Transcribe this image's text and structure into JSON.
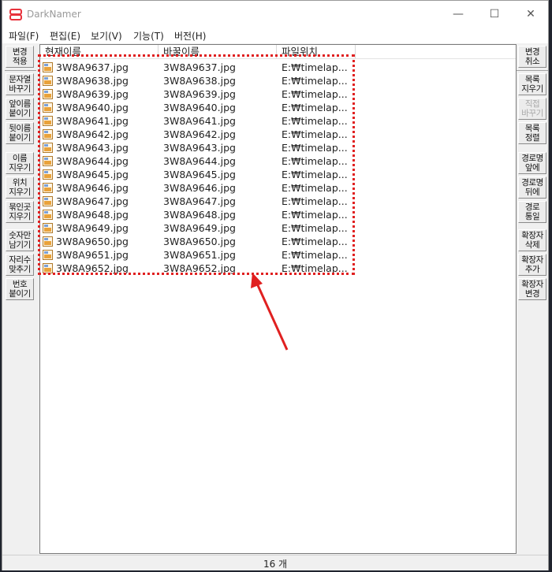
{
  "window": {
    "title": "DarkNamer",
    "minimize": "—",
    "maximize": "☐",
    "close": "✕"
  },
  "menu": [
    {
      "label": "파일(F)"
    },
    {
      "label": "편집(E)"
    },
    {
      "label": "보기(V)"
    },
    {
      "label": "기능(T)"
    },
    {
      "label": "버전(H)"
    }
  ],
  "left_buttons": [
    {
      "label": "변경\n적용"
    },
    {
      "label": "문자열\n바꾸기"
    },
    {
      "label": "앞이름\n붙이기"
    },
    {
      "label": "뒷이름\n붙이기"
    },
    {
      "label": "이름\n지우기"
    },
    {
      "label": "위치\n지우기"
    },
    {
      "label": "묶인곳\n지우기"
    },
    {
      "label": "숫자만\n남기기"
    },
    {
      "label": "자리수\n맞추기"
    },
    {
      "label": "번호\n붙이기"
    }
  ],
  "right_buttons": [
    {
      "label": "변경\n취소",
      "enabled": true
    },
    {
      "label": "목록\n지우기",
      "enabled": true
    },
    {
      "label": "직접\n바꾸기",
      "enabled": false
    },
    {
      "label": "목록\n정렬",
      "enabled": true
    },
    {
      "label": "경로명\n앞에",
      "enabled": true
    },
    {
      "label": "경로명\n뒤에",
      "enabled": true
    },
    {
      "label": "경로\n통일",
      "enabled": true
    },
    {
      "label": "확장자\n삭제",
      "enabled": true
    },
    {
      "label": "확장자\n추가",
      "enabled": true
    },
    {
      "label": "확장자\n변경",
      "enabled": true
    }
  ],
  "list": {
    "columns": [
      "현재이름",
      "바꿀이름",
      "파일위치"
    ],
    "icon": "jpg-file-icon",
    "rows": [
      [
        "3W8A9637.jpg",
        "3W8A9637.jpg",
        "E:₩timelap..."
      ],
      [
        "3W8A9638.jpg",
        "3W8A9638.jpg",
        "E:₩timelap..."
      ],
      [
        "3W8A9639.jpg",
        "3W8A9639.jpg",
        "E:₩timelap..."
      ],
      [
        "3W8A9640.jpg",
        "3W8A9640.jpg",
        "E:₩timelap..."
      ],
      [
        "3W8A9641.jpg",
        "3W8A9641.jpg",
        "E:₩timelap..."
      ],
      [
        "3W8A9642.jpg",
        "3W8A9642.jpg",
        "E:₩timelap..."
      ],
      [
        "3W8A9643.jpg",
        "3W8A9643.jpg",
        "E:₩timelap..."
      ],
      [
        "3W8A9644.jpg",
        "3W8A9644.jpg",
        "E:₩timelap..."
      ],
      [
        "3W8A9645.jpg",
        "3W8A9645.jpg",
        "E:₩timelap..."
      ],
      [
        "3W8A9646.jpg",
        "3W8A9646.jpg",
        "E:₩timelap..."
      ],
      [
        "3W8A9647.jpg",
        "3W8A9647.jpg",
        "E:₩timelap..."
      ],
      [
        "3W8A9648.jpg",
        "3W8A9648.jpg",
        "E:₩timelap..."
      ],
      [
        "3W8A9649.jpg",
        "3W8A9649.jpg",
        "E:₩timelap..."
      ],
      [
        "3W8A9650.jpg",
        "3W8A9650.jpg",
        "E:₩timelap..."
      ],
      [
        "3W8A9651.jpg",
        "3W8A9651.jpg",
        "E:₩timelap..."
      ],
      [
        "3W8A9652.jpg",
        "3W8A9652.jpg",
        "E:₩timelap..."
      ]
    ]
  },
  "status": {
    "count_text": "16 개"
  },
  "annotation": {
    "color": "#e02020"
  },
  "colors": {
    "app_icon": "#e8323c",
    "jpg_icon": "#e9a23b"
  }
}
